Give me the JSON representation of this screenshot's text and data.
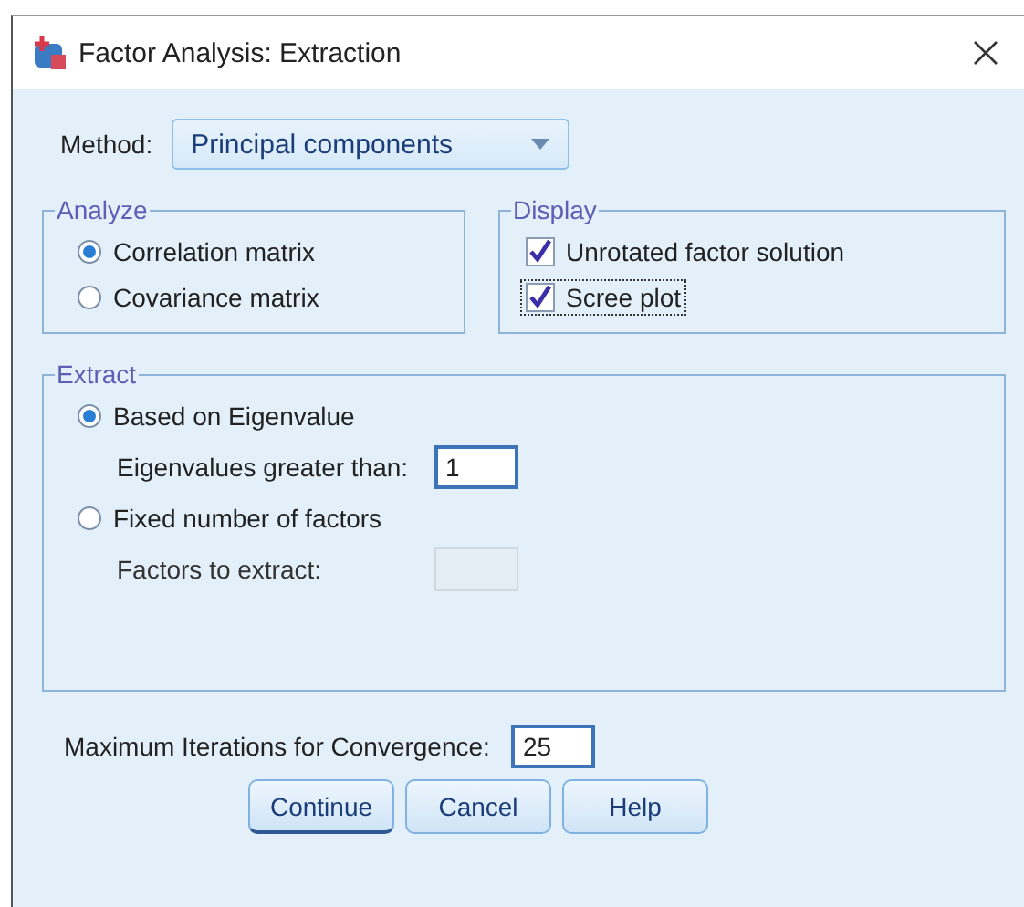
{
  "window": {
    "title": "Factor Analysis: Extraction"
  },
  "method": {
    "label": "Method:",
    "value": "Principal components"
  },
  "analyze": {
    "title": "Analyze",
    "options": [
      {
        "label": "Correlation matrix",
        "selected": true
      },
      {
        "label": "Covariance matrix",
        "selected": false
      }
    ]
  },
  "display": {
    "title": "Display",
    "options": [
      {
        "label": "Unrotated factor solution",
        "checked": true,
        "focused": false
      },
      {
        "label": "Scree plot",
        "checked": true,
        "focused": true
      }
    ]
  },
  "extract": {
    "title": "Extract",
    "options": [
      {
        "label": "Based on Eigenvalue",
        "selected": true,
        "field_label": "Eigenvalues greater than:",
        "value": "1",
        "disabled": false
      },
      {
        "label": "Fixed number of factors",
        "selected": false,
        "field_label": "Factors to extract:",
        "disabled": true
      }
    ]
  },
  "iterations": {
    "label": "Maximum Iterations for Convergence:",
    "value": "25"
  },
  "buttons": [
    {
      "label": "Continue",
      "default": true
    },
    {
      "label": "Cancel",
      "default": false
    },
    {
      "label": "Help",
      "default": false
    }
  ]
}
